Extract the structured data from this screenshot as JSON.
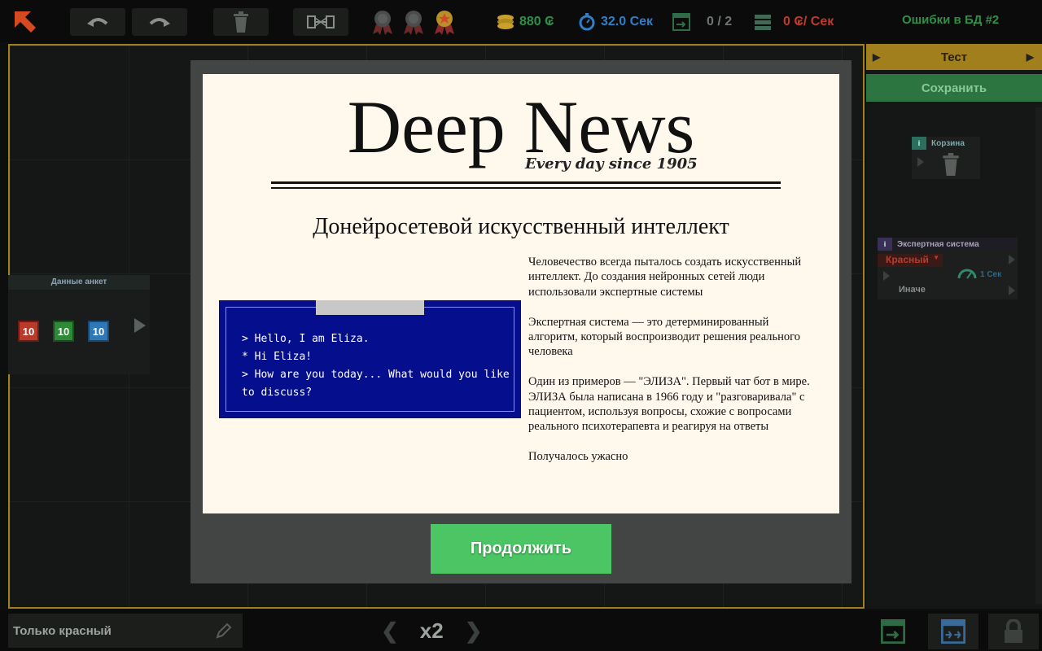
{
  "topbar": {
    "coins": "880 ₢",
    "time": "32.0 Сек",
    "progress": "0 / 2",
    "rate": "0 ₢/ Сек",
    "level_title": "Ошибки в БД #2"
  },
  "left_node": {
    "title": "Данные анкет",
    "chips": [
      {
        "value": "10",
        "color": "#b93a2a"
      },
      {
        "value": "10",
        "color": "#2f8a38"
      },
      {
        "value": "10",
        "color": "#2e78b8"
      }
    ]
  },
  "right_panel": {
    "test_label": "Тест",
    "save_label": "Сохранить",
    "trash_card_title": "Корзина",
    "expert_card_title": "Экспертная система",
    "expert_color_select": "Красный",
    "expert_timer": "1 Сек",
    "expert_else": "Иначе"
  },
  "bottombar": {
    "filter_text": "Только красный",
    "speed": "x2"
  },
  "modal": {
    "masthead": "Deep News",
    "tagline": "Every day since 1905",
    "headline": "Донейросетевой искусственный интеллект",
    "eliza_lines": [
      "> Hello, I am Eliza.",
      "* Hi Eliza!",
      "> How are you today... What would you like to discuss?"
    ],
    "paragraphs": [
      "Человечество всегда пыталось создать искусственный интеллект. До создания нейронных сетей люди использовали экспертные системы",
      "Экспертная система — это детерминированный алгоритм, который воспроизводит решения реального человека",
      "Один из примеров — \"ЭЛИЗА\". Первый чат бот в мире. ЭЛИЗА была написана в 1966 году и \"разговаривала\" с пациентом, используя вопросы, схожие с вопросами реального психотерапевта и реагируя на ответы",
      "Получалось ужасно"
    ],
    "continue_label": "Продолжить"
  },
  "colors": {
    "accent_gold": "#a07f1c",
    "accent_green": "#4cc665",
    "coin_yellow": "#c9a12a",
    "time_blue": "#2f7fc8",
    "rate_red": "#c0392b"
  }
}
